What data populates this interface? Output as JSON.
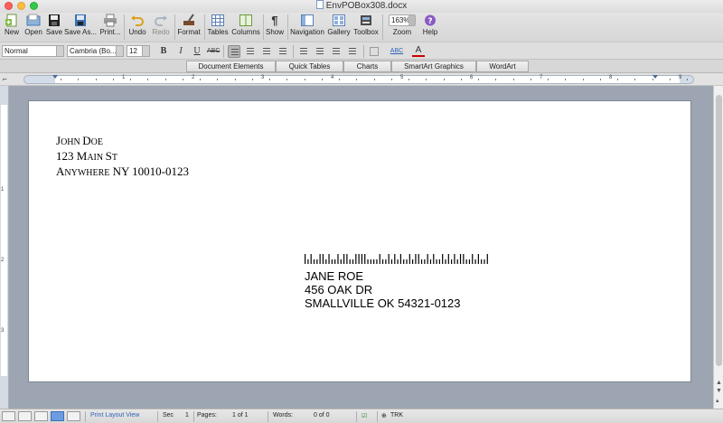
{
  "window": {
    "title": "EnvPOBox308.docx"
  },
  "toolbar": {
    "items": [
      {
        "label": "New"
      },
      {
        "label": "Open"
      },
      {
        "label": "Save"
      },
      {
        "label": "Save As..."
      },
      {
        "label": "Print..."
      },
      {
        "label": "Undo"
      },
      {
        "label": "Redo"
      },
      {
        "label": "Format"
      },
      {
        "label": "Tables"
      },
      {
        "label": "Columns"
      },
      {
        "label": "Show"
      },
      {
        "label": "Navigation"
      },
      {
        "label": "Gallery"
      },
      {
        "label": "Toolbox"
      },
      {
        "label": "Zoom"
      },
      {
        "label": "Help"
      }
    ],
    "zoom_value": "163%"
  },
  "formatbar": {
    "style": "Normal",
    "font": "Cambria (Bo...",
    "size": "12",
    "bold": "B",
    "italic": "I",
    "underline": "U",
    "strike": "ABC",
    "highlight": "ABC",
    "fontcolor": "A"
  },
  "ribbon": {
    "tabs": [
      "Document Elements",
      "Quick Tables",
      "Charts",
      "SmartArt Graphics",
      "WordArt"
    ]
  },
  "ruler": {
    "numbers": [
      "1",
      "2",
      "3",
      "4",
      "5",
      "6",
      "7",
      "8",
      "9"
    ]
  },
  "vruler": {
    "numbers": [
      "1",
      "2",
      "3"
    ]
  },
  "document": {
    "return_address": {
      "name": [
        "J",
        "OHN ",
        "D",
        "OE"
      ],
      "street": [
        "123 M",
        "AIN ",
        "S",
        "T"
      ],
      "city": [
        "A",
        "NYWHERE",
        " NY 10010-0123"
      ]
    },
    "recipient": {
      "line1": "JANE ROE",
      "line2": "456 OAK DR",
      "line3": "SMALLVILLE OK 54321-0123"
    },
    "barcode_bars": [
      1,
      0,
      1,
      0,
      0,
      1,
      1,
      0,
      1,
      0,
      0,
      1,
      0,
      1,
      1,
      0,
      0,
      1,
      1,
      1,
      1,
      0,
      0,
      0,
      0,
      1,
      0,
      0,
      1,
      0,
      1,
      0,
      1,
      0,
      0,
      1,
      0,
      1,
      1,
      0,
      0,
      1,
      0,
      1,
      0,
      0,
      1,
      0,
      1,
      0,
      1,
      0,
      1,
      1,
      0,
      0,
      1,
      0,
      1,
      0,
      0,
      1
    ]
  },
  "statusbar": {
    "view": "Print Layout View",
    "sec_label": "Sec",
    "sec_value": "1",
    "pages_label": "Pages:",
    "pages_value": "1 of 1",
    "words_label": "Words:",
    "words_value": "0 of 0",
    "trk": "TRK"
  },
  "colors": {
    "accent": "#2f63b5",
    "workspace": "#9da5b2",
    "page": "#ffffff"
  }
}
